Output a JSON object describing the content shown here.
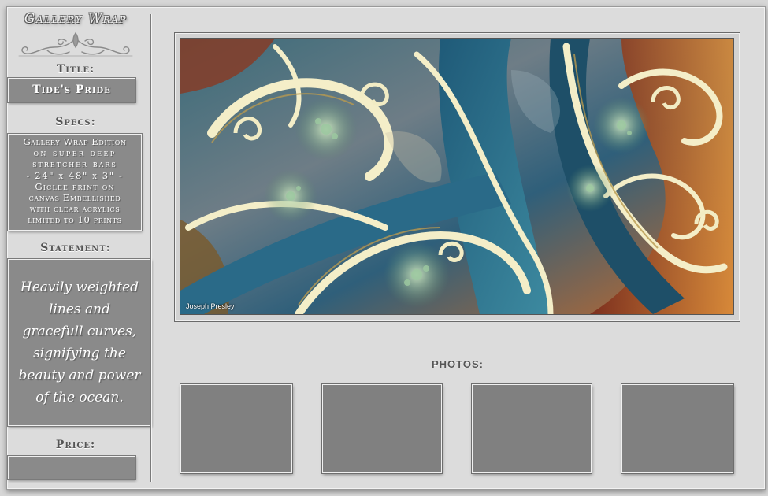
{
  "logo": {
    "text": "Gallery Wrap",
    "icon": "flourish-ornament"
  },
  "sidebar": {
    "title_label": "Title:",
    "title_value": "Tide's Pride",
    "specs_label": "Specs:",
    "specs_lines": [
      "Gallery Wrap Edition",
      "on super deep",
      "stretcher bars",
      "- 24\" x 48\" x 3\" -",
      "Giclee print on",
      "canvas Embellished",
      "with clear acrylics",
      "limited to 10 prints"
    ],
    "statement_label": "Statement:",
    "statement_value": "Heavily weighted lines and gracefull curves, signifying the beauty and power of the ocean.",
    "price_label": "Price:",
    "price_value": ""
  },
  "artwork": {
    "watermark": "Joseph Presley"
  },
  "photos": {
    "label": "PHOTOS:",
    "count": 4
  },
  "colors": {
    "panel_bg": "#dcdcdc",
    "box_bg": "#8a8a8a",
    "thumb_bg": "#808080",
    "label_text": "#555555"
  }
}
